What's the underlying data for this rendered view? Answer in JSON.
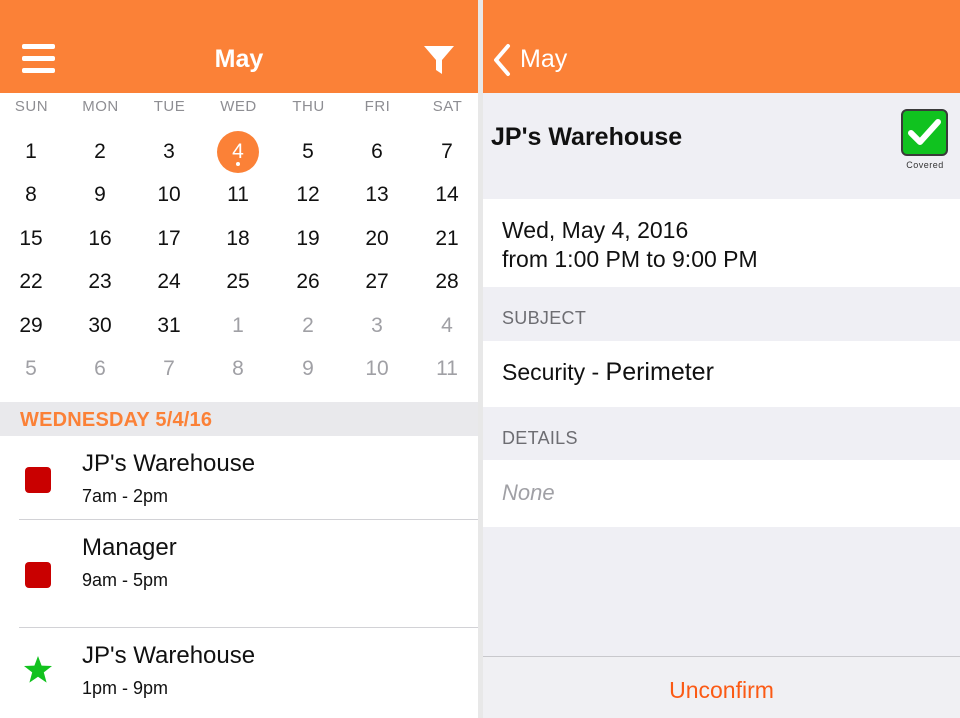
{
  "calendar": {
    "title": "May",
    "weekdays": [
      "SUN",
      "MON",
      "TUE",
      "WED",
      "THU",
      "FRI",
      "SAT"
    ],
    "weeks": [
      [
        "1",
        "2",
        "3",
        "4",
        "5",
        "6",
        "7"
      ],
      [
        "8",
        "9",
        "10",
        "11",
        "12",
        "13",
        "14"
      ],
      [
        "15",
        "16",
        "17",
        "18",
        "19",
        "20",
        "21"
      ],
      [
        "22",
        "23",
        "24",
        "25",
        "26",
        "27",
        "28"
      ],
      [
        "29",
        "30",
        "31",
        "1",
        "2",
        "3",
        "4"
      ],
      [
        "5",
        "6",
        "7",
        "8",
        "9",
        "10",
        "11"
      ]
    ],
    "selected_day": "4",
    "selected_date_header": "WEDNESDAY 5/4/16"
  },
  "events": [
    {
      "title": "JP's Warehouse",
      "time": "7am - 2pm",
      "marker": "red-square-icon"
    },
    {
      "title": "Manager",
      "time": "9am - 5pm",
      "marker": "red-square-icon"
    },
    {
      "title": "JP's Warehouse",
      "time": "1pm - 9pm",
      "marker": "green-star-icon"
    }
  ],
  "detail": {
    "back_label": "May",
    "location": "JP's Warehouse",
    "covered_label": "Covered",
    "date_line": "Wed, May 4, 2016",
    "time_line": "from 1:00 PM to 9:00 PM",
    "subject_label": "SUBJECT",
    "subject_prefix": "Security -",
    "subject_value": "Perimeter",
    "details_label": "DETAILS",
    "details_value": "None",
    "unconfirm_label": "Unconfirm"
  },
  "colors": {
    "accent": "#fb8137",
    "covered_green": "#10c21f",
    "event_red": "#c90000",
    "star_green": "#12c21e",
    "unconfirm": "#fb5a14"
  }
}
